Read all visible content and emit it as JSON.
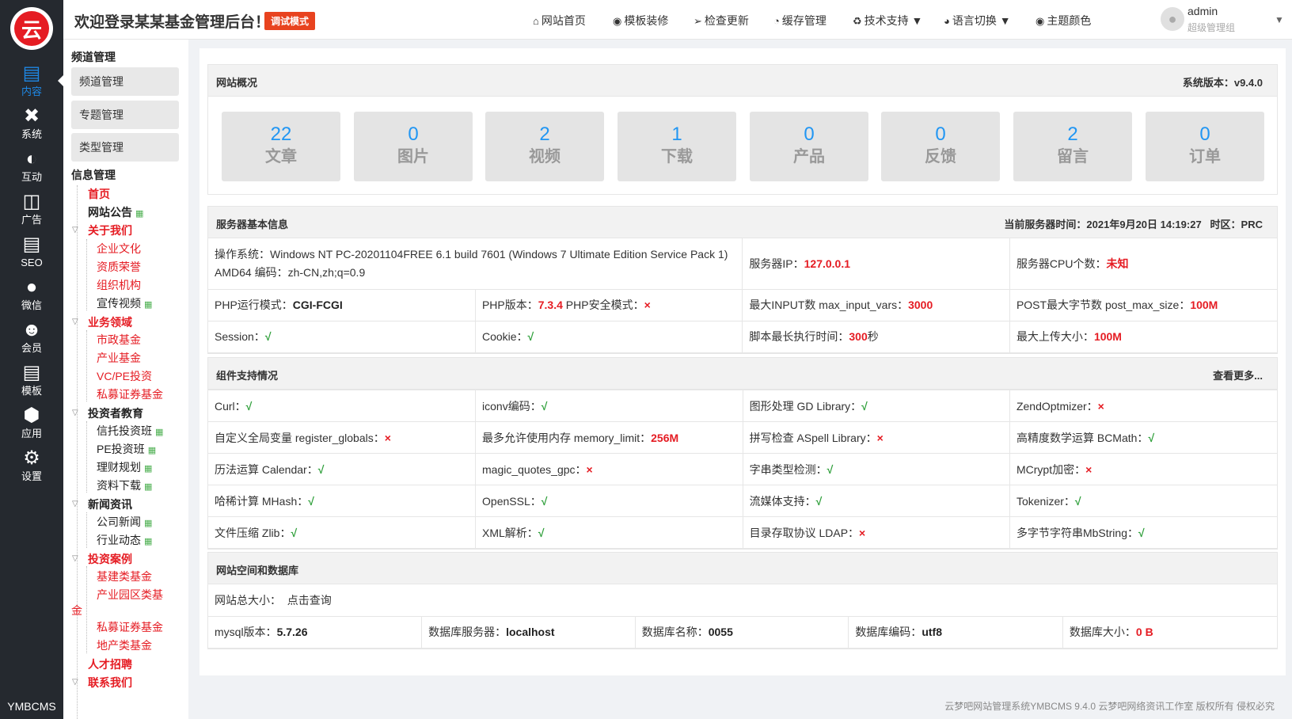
{
  "rail": {
    "items": [
      {
        "label": "内容",
        "icon": "content-icon"
      },
      {
        "label": "系统",
        "icon": "tools-icon"
      },
      {
        "label": "互动",
        "icon": "interact-icon"
      },
      {
        "label": "广告",
        "icon": "ad-icon"
      },
      {
        "label": "SEO",
        "icon": "chart-icon"
      },
      {
        "label": "微信",
        "icon": "wechat-icon"
      },
      {
        "label": "会员",
        "icon": "member-icon"
      },
      {
        "label": "模板",
        "icon": "template-icon"
      },
      {
        "label": "应用",
        "icon": "cube-icon"
      },
      {
        "label": "设置",
        "icon": "gear-icon"
      }
    ],
    "brand": "YMBCMS",
    "logo_char": "云"
  },
  "topbar": {
    "welcome": "欢迎登录某某基金管理后台！",
    "debug_badge": "调试模式",
    "nav": [
      "网站首页",
      "模板装修",
      "检查更新",
      "缓存管理",
      "技术支持",
      "语言切换",
      "主题颜色"
    ],
    "user_name": "admin",
    "user_role": "超级管理组"
  },
  "submenu": {
    "channel_title": "频道管理",
    "channel_buttons": [
      "频道管理",
      "专题管理",
      "类型管理"
    ],
    "info_title": "信息管理",
    "tree": [
      "首页",
      "网站公告",
      "关于我们",
      "企业文化",
      "资质荣誉",
      "组织机构",
      "宣传视频",
      "业务领域",
      "市政基金",
      "产业基金",
      "VC/PE投资",
      "私募证券基金",
      "投资者教育",
      "信托投资班",
      "PE投资班",
      "理财规划",
      "资料下载",
      "新闻资讯",
      "公司新闻",
      "行业动态",
      "投资案例",
      "基建类基金",
      "产业园区类基",
      "金",
      "私募证券基金",
      "地产类基金",
      "人才招聘",
      "联系我们"
    ]
  },
  "overview": {
    "title": "网站概况",
    "version_label": "系统版本：",
    "version": "v9.4.0",
    "stats": [
      {
        "value": "22",
        "label": "文章"
      },
      {
        "value": "0",
        "label": "图片"
      },
      {
        "value": "2",
        "label": "视频"
      },
      {
        "value": "1",
        "label": "下载"
      },
      {
        "value": "0",
        "label": "产品"
      },
      {
        "value": "0",
        "label": "反馈"
      },
      {
        "value": "2",
        "label": "留言"
      },
      {
        "value": "0",
        "label": "订单"
      }
    ]
  },
  "server": {
    "title": "服务器基本信息",
    "time_label": "当前服务器时间：",
    "time": "2021年9月20日 14:19:27",
    "tz_label": "时区：",
    "tz": "PRC",
    "os_label": "操作系统：",
    "os": "Windows NT PC-20201104FREE 6.1 build 7601 (Windows 7 Ultimate Edition Service Pack 1) AMD64 编码：zh-CN,zh;q=0.9",
    "ip_label": "服务器IP：",
    "ip": "127.0.0.1",
    "cpu_label": "服务器CPU个数：",
    "cpu": "未知",
    "php_mode_label": "PHP运行模式：",
    "php_mode": "CGI-FCGI",
    "php_ver_label": "PHP版本：",
    "php_ver": "7.3.4",
    "php_safe_label": " PHP安全模式：",
    "php_safe": "×",
    "max_input_label": "最大INPUT数 max_input_vars：",
    "max_input": "3000",
    "post_max_label": "POST最大字节数 post_max_size：",
    "post_max": "100M",
    "session_label": "Session：",
    "session": "√",
    "cookie_label": "Cookie：",
    "cookie": "√",
    "exec_label": "脚本最长执行时间：",
    "exec": "300",
    "exec_unit": "秒",
    "upload_label": "最大上传大小：",
    "upload": "100M"
  },
  "components": {
    "title": "组件支持情况",
    "more": "查看更多...",
    "rows": [
      [
        [
          "Curl：",
          "√",
          "ok"
        ],
        [
          "iconv编码：",
          "√",
          "ok"
        ],
        [
          "图形处理 GD Library：",
          "√",
          "ok"
        ],
        [
          "ZendOptmizer：",
          "×",
          "no"
        ]
      ],
      [
        [
          "自定义全局变量 register_globals：",
          "×",
          "no"
        ],
        [
          "最多允许使用内存 memory_limit：",
          "256M",
          "val"
        ],
        [
          "拼写检查 ASpell Library：",
          "×",
          "no"
        ],
        [
          "高精度数学运算 BCMath：",
          "√",
          "ok"
        ]
      ],
      [
        [
          "历法运算 Calendar：",
          "√",
          "ok"
        ],
        [
          "magic_quotes_gpc：",
          "×",
          "no"
        ],
        [
          "字串类型检测：",
          "√",
          "ok"
        ],
        [
          "MCrypt加密：",
          "×",
          "no"
        ]
      ],
      [
        [
          "哈稀计算 MHash：",
          "√",
          "ok"
        ],
        [
          "OpenSSL：",
          "√",
          "ok"
        ],
        [
          "流媒体支持：",
          "√",
          "ok"
        ],
        [
          "Tokenizer：",
          "√",
          "ok"
        ]
      ],
      [
        [
          "文件压缩 Zlib：",
          "√",
          "ok"
        ],
        [
          "XML解析：",
          "√",
          "ok"
        ],
        [
          "目录存取协议 LDAP：",
          "×",
          "no"
        ],
        [
          "多字节字符串MbString：",
          "√",
          "ok"
        ]
      ]
    ]
  },
  "space": {
    "title": "网站空间和数据库",
    "size_label": "网站总大小：",
    "size_link": "点击查询",
    "mysql_label": "mysql版本：",
    "mysql": "5.7.26",
    "dbhost_label": "数据库服务器：",
    "dbhost": "localhost",
    "dbname_label": "数据库名称：",
    "dbname": "0055",
    "dbcharset_label": "数据库编码：",
    "dbcharset": "utf8",
    "dbsize_label": "数据库大小：",
    "dbsize": "0 B"
  },
  "footer": "云梦吧网站管理系统YMBCMS 9.4.0  云梦吧网络资讯工作室 版权所有 侵权必究"
}
